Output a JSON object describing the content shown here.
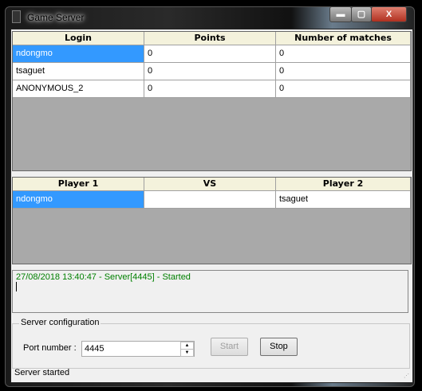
{
  "window": {
    "title": "Game Server",
    "minimize": "▬",
    "maximize": "▢",
    "close": "X"
  },
  "players_table": {
    "columns": [
      "Login",
      "Points",
      "Number of matches"
    ],
    "rows": [
      [
        "ndongmo",
        "0",
        "0"
      ],
      [
        "tsaguet",
        "0",
        "0"
      ],
      [
        "ANONYMOUS_2",
        "0",
        "0"
      ]
    ]
  },
  "matches_table": {
    "columns": [
      "Player 1",
      "VS",
      "Player 2"
    ],
    "rows": [
      [
        "ndongmo",
        "",
        "tsaguet"
      ]
    ]
  },
  "log": {
    "lines": [
      "27/08/2018 13:40:47 - Server[4445] - Started"
    ],
    "color": "#008000"
  },
  "config": {
    "group_label": "Server configuration",
    "port_label": "Port number :",
    "port_value": "4445",
    "start_label": "Start",
    "stop_label": "Stop"
  },
  "status": "Server started"
}
